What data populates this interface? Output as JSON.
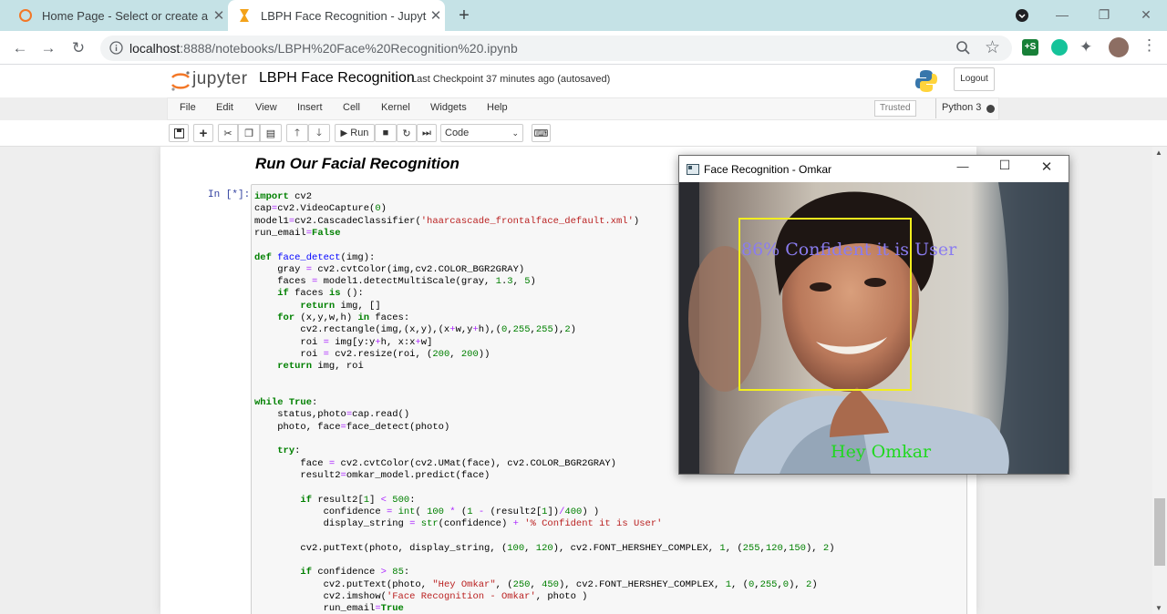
{
  "browser": {
    "tabs": [
      {
        "title": "Home Page - Select or create a n",
        "active": false
      },
      {
        "title": "LBPH Face Recognition - Jupyter",
        "active": true
      }
    ],
    "url_host": "localhost",
    "url_rest": ":8888/notebooks/LBPH%20Face%20Recognition%20.ipynb"
  },
  "jupyter": {
    "logo_text": "jupyter",
    "notebook_name": "LBPH Face Recognition",
    "checkpoint_label": "Last Checkpoint",
    "checkpoint_time": "37 minutes ago",
    "save_status": "(autosaved)",
    "logout_label": "Logout",
    "menu": [
      "File",
      "Edit",
      "View",
      "Insert",
      "Cell",
      "Kernel",
      "Widgets",
      "Help"
    ],
    "trusted_label": "Trusted",
    "kernel_name": "Python 3",
    "run_label": "Run",
    "cell_type": "Code"
  },
  "cells": {
    "heading": "Run Our Facial Recognition",
    "prompt": "In [*]:",
    "code": [
      "import cv2",
      "cap=cv2.VideoCapture(0)",
      "model1=cv2.CascadeClassifier('haarcascade_frontalface_default.xml')",
      "run_email=False",
      "",
      "def face_detect(img):",
      "    gray = cv2.cvtColor(img,cv2.COLOR_BGR2GRAY)",
      "    faces = model1.detectMultiScale(gray, 1.3, 5)",
      "    if faces is ():",
      "        return img, []",
      "    for (x,y,w,h) in faces:",
      "        cv2.rectangle(img,(x,y),(x+w,y+h),(0,255,255),2)",
      "        roi = img[y:y+h, x:x+w]",
      "        roi = cv2.resize(roi, (200, 200))",
      "    return img, roi",
      "",
      "",
      "while True:",
      "    status,photo=cap.read()",
      "    photo, face=face_detect(photo)",
      "",
      "    try:",
      "        face = cv2.cvtColor(cv2.UMat(face), cv2.COLOR_BGR2GRAY)",
      "        result2=omkar_model.predict(face)",
      "",
      "        if result2[1] < 500:",
      "            confidence = int( 100 * (1 - (result2[1])/400) )",
      "            display_string = str(confidence) + '% Confident it is User'",
      "",
      "        cv2.putText(photo, display_string, (100, 120), cv2.FONT_HERSHEY_COMPLEX, 1, (255,120,150), 2)",
      "",
      "        if confidence > 85:",
      "            cv2.putText(photo, \"Hey Omkar\", (250, 450), cv2.FONT_HERSHEY_COMPLEX, 1, (0,255,0), 2)",
      "            cv2.imshow('Face Recognition - Omkar', photo )",
      "            run_email=True"
    ]
  },
  "cv_window": {
    "title": "Face Recognition - Omkar",
    "confidence_text": "86% Confident it is User",
    "greeting_text": "Hey Omkar"
  },
  "colors": {
    "chrome_tabstrip": "#c5e2e6",
    "confidence_text": "#8a7cf0",
    "greeting_text": "#1fd81f",
    "face_box": "#f2ee1e"
  }
}
